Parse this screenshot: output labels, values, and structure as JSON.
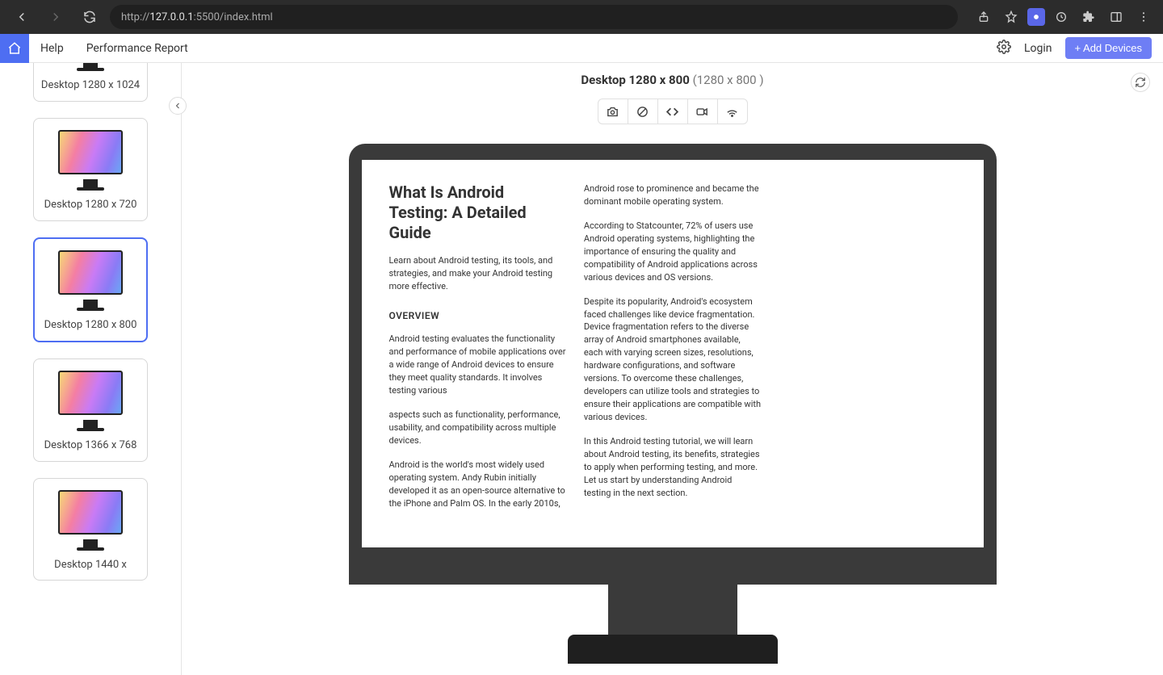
{
  "browser": {
    "url_prefix": "http://",
    "url_host": "127.0.0.1",
    "url_path": ":5500/index.html"
  },
  "topbar": {
    "help": "Help",
    "performance": "Performance Report",
    "login": "Login",
    "add_devices": "+ Add Devices"
  },
  "sidebar": {
    "devices": [
      {
        "label": "Desktop 1280 x 1024",
        "selected": false
      },
      {
        "label": "Desktop 1280 x 720",
        "selected": false
      },
      {
        "label": "Desktop 1280 x 800",
        "selected": true
      },
      {
        "label": "Desktop 1366 x 768",
        "selected": false
      },
      {
        "label": "Desktop 1440 x",
        "selected": false
      }
    ]
  },
  "viewport": {
    "title": "Desktop 1280 x 800",
    "dims": "(1280 x 800 )"
  },
  "content": {
    "h1": "What Is Android Testing: A Detailed Guide",
    "lead": "Learn about Android testing, its tools, and strategies, and make your Android testing more effective.",
    "overview_h": "OVERVIEW",
    "p1": "Android testing evaluates the functionality and performance of mobile applications over a wide range of Android devices to ensure they meet quality standards. It involves testing various",
    "p2": "aspects such as functionality, performance, usability, and compatibility across multiple devices.",
    "p3": "Android is the world's most widely used operating system. Andy Rubin initially developed it as an open-source alternative to the iPhone and Palm OS. In the early 2010s, Android rose to prominence and became the dominant mobile operating system.",
    "p4": "According to Statcounter, 72% of users use Android operating systems, highlighting the importance of ensuring the quality and compatibility of Android applications across various devices and OS versions.",
    "p5": "Despite its popularity, Android's ecosystem faced challenges like device fragmentation. Device fragmentation refers to the diverse array of Android smartphones available, each with varying screen sizes, resolutions, hardware configurations, and software versions. To overcome these challenges, developers can utilize tools and strategies to ensure their applications are compatible with various devices.",
    "p6": "In this Android testing tutorial, we will learn about Android testing, its benefits, strategies to apply when performing testing, and more. Let us start by understanding Android testing in the next section."
  }
}
